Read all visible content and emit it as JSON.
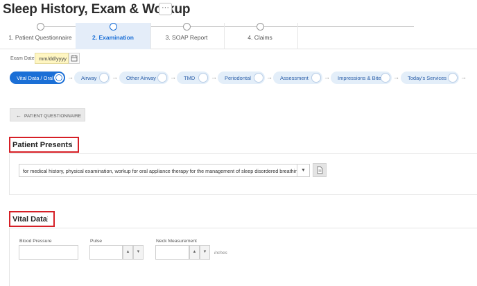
{
  "header": {
    "title": "Sleep History, Exam & Workup",
    "more_label": "···"
  },
  "tabs": [
    {
      "label": "1. Patient Questionnaire"
    },
    {
      "label": "2. Examination"
    },
    {
      "label": "3. SOAP Report"
    },
    {
      "label": "4. Claims"
    }
  ],
  "exam_date": {
    "label": "Exam Date",
    "placeholder": "mm/dd/yyyy"
  },
  "sub_tabs": [
    {
      "label": "Vital Data / Oral"
    },
    {
      "label": "Airway"
    },
    {
      "label": "Other Airway"
    },
    {
      "label": "TMD"
    },
    {
      "label": "Periodontal"
    },
    {
      "label": "Assessment"
    },
    {
      "label": "Impressions & Bite"
    },
    {
      "label": "Today's Services"
    }
  ],
  "patient_questionnaire_button": "PATIENT QUESTIONNAIRE",
  "patient_presents": {
    "title": "Patient Presents",
    "value": "for medical history, physical examination, workup for oral appliance therapy for the management of sleep disordered breathing"
  },
  "vital_data": {
    "title": "Vital Data",
    "blood_pressure_label": "Blood Pressure",
    "pulse_label": "Pulse",
    "neck_label": "Neck Measurement",
    "neck_unit": "inches"
  },
  "colors": {
    "accent": "#1b6fd6",
    "highlight_border": "#d61f26",
    "date_bg": "#fff6c2"
  }
}
